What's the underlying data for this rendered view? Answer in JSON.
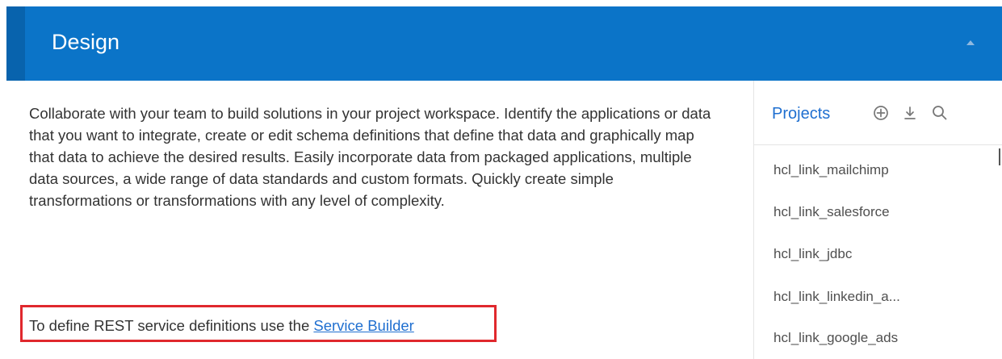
{
  "header": {
    "title": "Design",
    "collapse_icon": "chevron-up-icon",
    "background_color": "#0b74c8"
  },
  "main": {
    "description": "Collaborate with your team to build solutions in your project workspace. Identify the applications or data that you want to integrate, create or edit schema definitions that define that data and graphically map that data to achieve the desired results. Easily incorporate data from packaged applications, multiple data sources, a wide range of data standards and custom formats. Quickly create simple transformations or transformations with any level of complexity.",
    "rest_prefix": "To define REST service definitions use the ",
    "rest_link": "Service Builder"
  },
  "projects": {
    "title": "Projects",
    "toolbar_icons": [
      "add-circle-icon",
      "download-icon",
      "search-icon"
    ],
    "items": [
      "hcl_link_mailchimp",
      "hcl_link_salesforce",
      "hcl_link_jdbc",
      "hcl_link_linkedin_a...",
      "hcl_link_google_ads"
    ]
  },
  "colors": {
    "accent": "#1f6fd0",
    "highlight": "#e0282d"
  }
}
